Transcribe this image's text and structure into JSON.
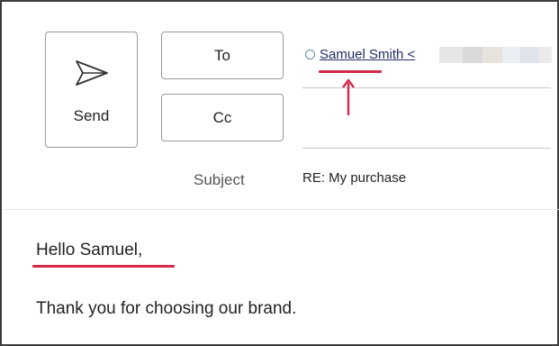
{
  "compose": {
    "send_label": "Send",
    "to_label": "To",
    "cc_label": "Cc",
    "subject_label": "Subject",
    "subject_value": "RE: My purchase",
    "recipient_display": "Samuel Smith <"
  },
  "message": {
    "greeting": "Hello Samuel,",
    "body": "Thank you for choosing our brand."
  },
  "colors": {
    "highlight": "#d6294a",
    "recipient_link": "#1f2d63",
    "presence_ring": "#5d8ab7"
  },
  "icons": {
    "send": "send-icon",
    "presence": "presence-status-icon",
    "annotation": "up-arrow-icon"
  }
}
